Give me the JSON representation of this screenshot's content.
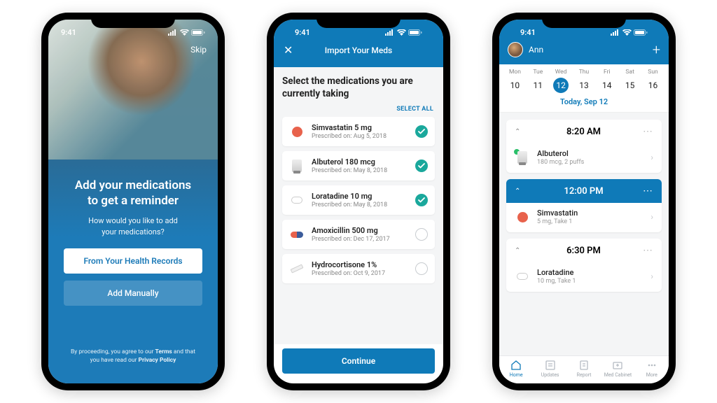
{
  "status_time": "9:41",
  "phone1": {
    "skip": "Skip",
    "title_l1": "Add your medications",
    "title_l2": "to get a reminder",
    "sub_l1": "How would you like to add",
    "sub_l2": "your medications?",
    "btn_records": "From Your Health Records",
    "btn_manual": "Add Manually",
    "footer_pre": "By proceeding, you agree to our ",
    "footer_terms": "Terms",
    "footer_mid": " and that you have read our ",
    "footer_privacy": "Privacy Policy"
  },
  "phone2": {
    "header_title": "Import Your Meds",
    "heading": "Select the medications you are currently taking",
    "select_all": "SELECT ALL",
    "meds": [
      {
        "name": "Simvastatin 5 mg",
        "sub": "Prescribed on: Aug 5, 2018",
        "selected": true,
        "icon": "pill-red"
      },
      {
        "name": "Albuterol 180 mcg",
        "sub": "Prescribed on: May 8, 2018",
        "selected": true,
        "icon": "pill-inhaler"
      },
      {
        "name": "Loratadine 10 mg",
        "sub": "Prescribed on: May 8, 2018",
        "selected": true,
        "icon": "pill-white"
      },
      {
        "name": "Amoxicillin 500 mg",
        "sub": "Prescribed on: Dec 17, 2017",
        "selected": false,
        "icon": "pill-cap"
      },
      {
        "name": "Hydrocortisone 1%",
        "sub": "Prescribed on: Oct 9, 2017",
        "selected": false,
        "icon": "pill-tube"
      }
    ],
    "continue": "Continue"
  },
  "phone3": {
    "user_name": "Ann",
    "days": [
      {
        "dow": "Mon",
        "num": "10",
        "sel": false
      },
      {
        "dow": "Tue",
        "num": "11",
        "sel": false
      },
      {
        "dow": "Wed",
        "num": "12",
        "sel": true
      },
      {
        "dow": "Thu",
        "num": "13",
        "sel": false
      },
      {
        "dow": "Fri",
        "num": "14",
        "sel": false
      },
      {
        "dow": "Sat",
        "num": "15",
        "sel": false
      },
      {
        "dow": "Sun",
        "num": "16",
        "sel": false
      }
    ],
    "today": "Today, Sep 12",
    "slots": [
      {
        "time": "8:20 AM",
        "highlight": false,
        "med": "Albuterol",
        "sub": "180 mcg, 2 puffs",
        "icon": "pill-inhaler",
        "taken": true
      },
      {
        "time": "12:00 PM",
        "highlight": true,
        "med": "Simvastatin",
        "sub": "5 mg, Take 1",
        "icon": "pill-red",
        "taken": false
      },
      {
        "time": "6:30 PM",
        "highlight": false,
        "med": "Loratadine",
        "sub": "10 mg, Take 1",
        "icon": "pill-white",
        "taken": false
      }
    ],
    "tabs": [
      {
        "label": "Home",
        "active": true
      },
      {
        "label": "Updates",
        "active": false
      },
      {
        "label": "Report",
        "active": false
      },
      {
        "label": "Med Cabinet",
        "active": false
      },
      {
        "label": "More",
        "active": false
      }
    ]
  }
}
